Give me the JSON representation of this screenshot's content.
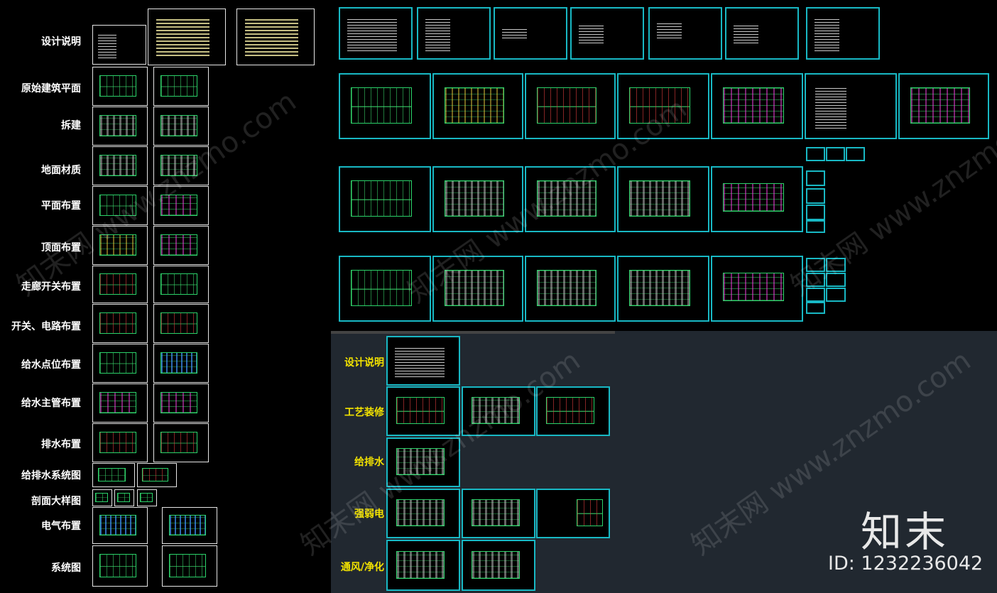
{
  "left_labels": [
    "设计说明",
    "原始建筑平面",
    "拆建",
    "地面材质",
    "平面布置",
    "顶面布置",
    "走廊开关布置",
    "开关、电路布置",
    "给水点位布置",
    "给水主管布置",
    "排水布置",
    "给排水系统图",
    "剖面大样图",
    "电气布置",
    "系统图"
  ],
  "panel_labels": [
    "设计说明",
    "工艺装修",
    "给排水",
    "强弱电",
    "通风/净化"
  ],
  "watermark": "知末网 www.znzmo.com",
  "brand": {
    "name": "知末",
    "id": "ID: 1232236042"
  },
  "colors": {
    "sheet_border_cyan": "#18b8c4",
    "label_yellow": "#f2e200",
    "panel_bg": "#212830"
  }
}
